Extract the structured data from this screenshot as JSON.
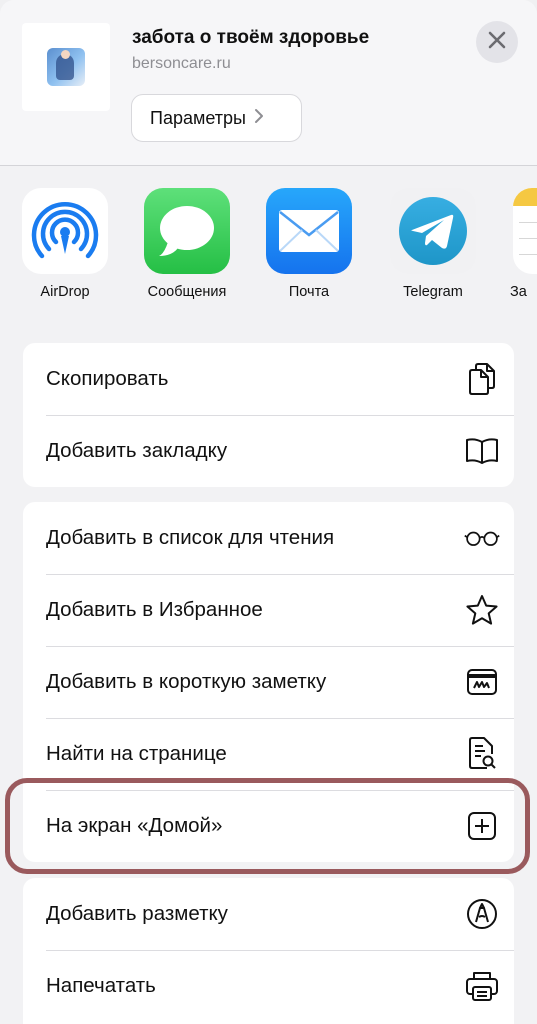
{
  "header": {
    "title": "забота о твоём здоровье",
    "url": "bersoncare.ru",
    "params_label": "Параметры",
    "close_icon": "close-icon"
  },
  "apps": [
    {
      "label": "AirDrop",
      "icon": "airdrop-icon"
    },
    {
      "label": "Сообщения",
      "icon": "messages-icon"
    },
    {
      "label": "Почта",
      "icon": "mail-icon"
    },
    {
      "label": "Telegram",
      "icon": "telegram-icon"
    },
    {
      "label": "За",
      "icon": "notes-icon"
    }
  ],
  "actions_group1": [
    {
      "label": "Скопировать",
      "icon": "copy-icon"
    },
    {
      "label": "Добавить закладку",
      "icon": "book-icon"
    }
  ],
  "actions_group2": [
    {
      "label": "Добавить в список для чтения",
      "icon": "glasses-icon"
    },
    {
      "label": "Добавить в Избранное",
      "icon": "star-icon"
    },
    {
      "label": "Добавить в короткую заметку",
      "icon": "quick-note-icon"
    },
    {
      "label": "Найти на странице",
      "icon": "find-in-page-icon"
    },
    {
      "label": "На экран «Домой»",
      "icon": "add-square-icon"
    }
  ],
  "actions_group3": [
    {
      "label": "Добавить разметку",
      "icon": "markup-icon"
    },
    {
      "label": "Напечатать",
      "icon": "printer-icon"
    }
  ],
  "colors": {
    "highlight": "#9a5a5d",
    "messages_green": "#34c759",
    "mail_blue": "#1e8cf7",
    "telegram_blue": "#2aa3e0",
    "airdrop_blue": "#1a7cf0"
  }
}
